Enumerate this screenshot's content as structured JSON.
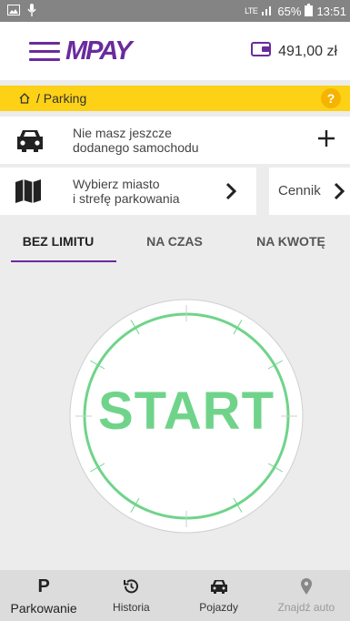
{
  "statusbar": {
    "network": "LTE",
    "battery": "65%",
    "time": "13:51"
  },
  "header": {
    "logo": "MPAY",
    "balance": "491,00 zł",
    "icons": {
      "menu": "hamburger-icon",
      "wallet": "wallet-icon"
    }
  },
  "breadcrumb": {
    "path": "/ Parking",
    "help": "?"
  },
  "car_card": {
    "line1": "Nie masz jeszcze",
    "line2": "dodanego samochodu",
    "icon": "car-icon",
    "action_icon": "plus-icon"
  },
  "zone_card": {
    "line1": "Wybierz miasto",
    "line2": "i strefę parkowania",
    "icon": "map-icon",
    "action_icon": "chevron-right-icon"
  },
  "price_card": {
    "label": "Cennik"
  },
  "tabs": [
    {
      "label": "BEZ LIMITU",
      "active": true
    },
    {
      "label": "NA CZAS",
      "active": false
    },
    {
      "label": "NA KWOTĘ",
      "active": false
    }
  ],
  "dial": {
    "start_label": "START"
  },
  "bottomnav": [
    {
      "label": "Parkowanie",
      "icon": "parking-icon"
    },
    {
      "label": "Historia",
      "icon": "history-icon"
    },
    {
      "label": "Pojazdy",
      "icon": "car-icon"
    },
    {
      "label": "Znajdź auto",
      "icon": "location-pin-icon"
    }
  ],
  "colors": {
    "brand": "#6a2b9e",
    "breadcrumb_bg": "#fcd116",
    "start_green": "#6fd48a"
  }
}
